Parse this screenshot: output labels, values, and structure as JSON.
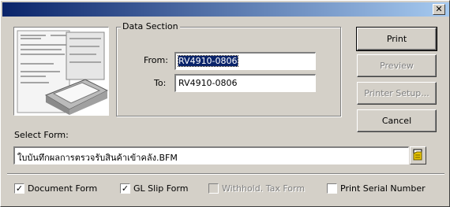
{
  "window": {
    "close_glyph": "✕"
  },
  "data_section": {
    "title": "Data Section",
    "from_label": "From:",
    "from_value": "RV4910-0806",
    "to_label": "To:",
    "to_value": "RV4910-0806"
  },
  "buttons": {
    "print": "Print",
    "preview": "Preview",
    "printer_setup": "Printer Setup...",
    "cancel": "Cancel"
  },
  "select_form": {
    "label": "Select Form:",
    "value": "ใบบันทึกผลการตรวจรับสินค้าเข้าคลัง.BFM",
    "browse_icon": "folder-browse-icon"
  },
  "checkboxes": [
    {
      "label": "Document Form",
      "checked": true,
      "enabled": true,
      "mark": "✓"
    },
    {
      "label": "GL Slip Form",
      "checked": true,
      "enabled": true,
      "mark": "✓"
    },
    {
      "label": "Withhold. Tax Form",
      "checked": false,
      "enabled": false,
      "mark": ""
    },
    {
      "label": "Print Serial Number",
      "checked": false,
      "enabled": true,
      "mark": ""
    }
  ],
  "colors": {
    "title_start": "#0a246a",
    "title_end": "#a6caf0",
    "face": "#d4d0c8",
    "selection": "#0a246a"
  }
}
